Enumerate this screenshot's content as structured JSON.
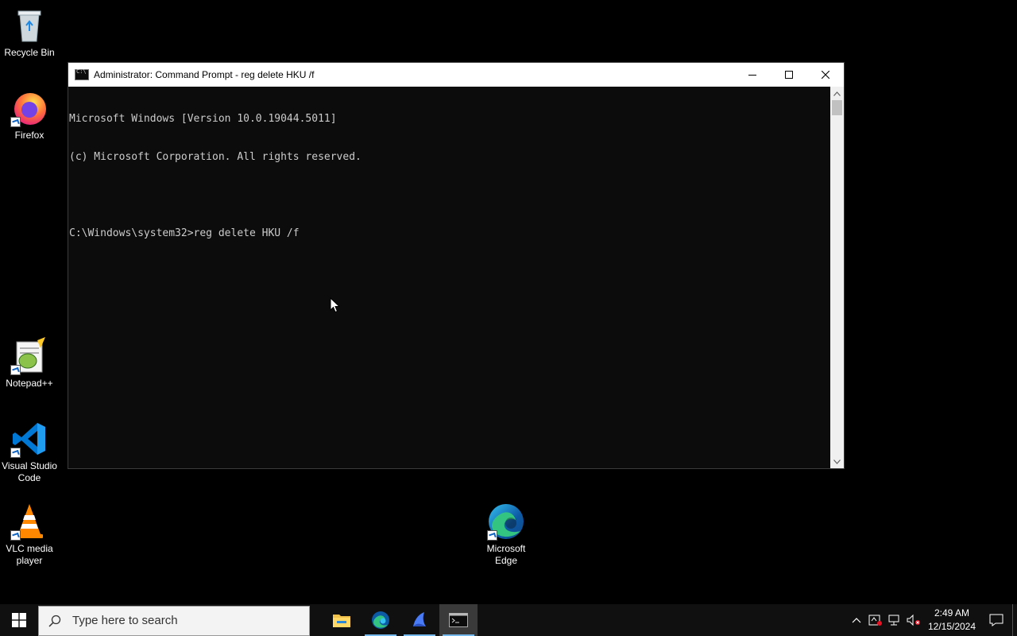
{
  "desktop": {
    "icons": [
      {
        "label": "Recycle Bin"
      },
      {
        "label": "Firefox"
      },
      {
        "label": "Notepad++"
      },
      {
        "label": "Visual Studio Code"
      },
      {
        "label": "VLC media player"
      },
      {
        "label": "Microsoft Edge"
      }
    ]
  },
  "cmd_window": {
    "title": "Administrator: Command Prompt - reg  delete HKU /f",
    "lines": [
      "Microsoft Windows [Version 10.0.19044.5011]",
      "(c) Microsoft Corporation. All rights reserved.",
      "",
      "C:\\Windows\\system32>reg delete HKU /f"
    ]
  },
  "taskbar": {
    "search_placeholder": "Type here to search",
    "apps": [
      "file-explorer",
      "microsoft-edge",
      "app-launcher",
      "command-prompt"
    ],
    "clock": {
      "time": "2:49 AM",
      "date": "12/15/2024"
    }
  },
  "colors": {
    "taskbar_bg": "#101010",
    "console_bg": "#0c0c0c",
    "console_text": "#cccccc",
    "accent": "#76b9ed"
  }
}
